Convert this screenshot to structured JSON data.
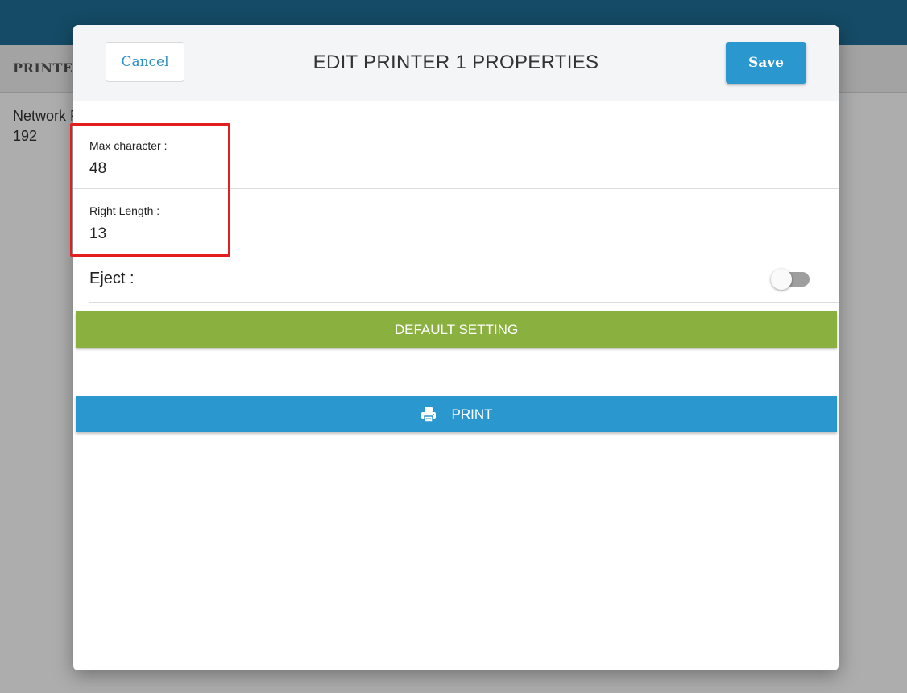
{
  "background": {
    "section_title": "PRINTER",
    "row_line1": "Network P",
    "row_line2": "192"
  },
  "modal": {
    "title": "EDIT PRINTER 1 PROPERTIES",
    "cancel_label": "Cancel",
    "save_label": "Save",
    "fields": [
      {
        "label": "Max character :",
        "value": "48"
      },
      {
        "label": "Right Length :",
        "value": "13"
      }
    ],
    "eject": {
      "label": "Eject :",
      "enabled": false
    },
    "default_setting_label": "DEFAULT SETTING",
    "print_label": "PRINT",
    "print_icon": "printer-icon"
  },
  "colors": {
    "header_bar": "#1f6f97",
    "primary_blue": "#2b97cf",
    "default_green": "#8ab03f",
    "highlight_red": "#e31e1e"
  }
}
